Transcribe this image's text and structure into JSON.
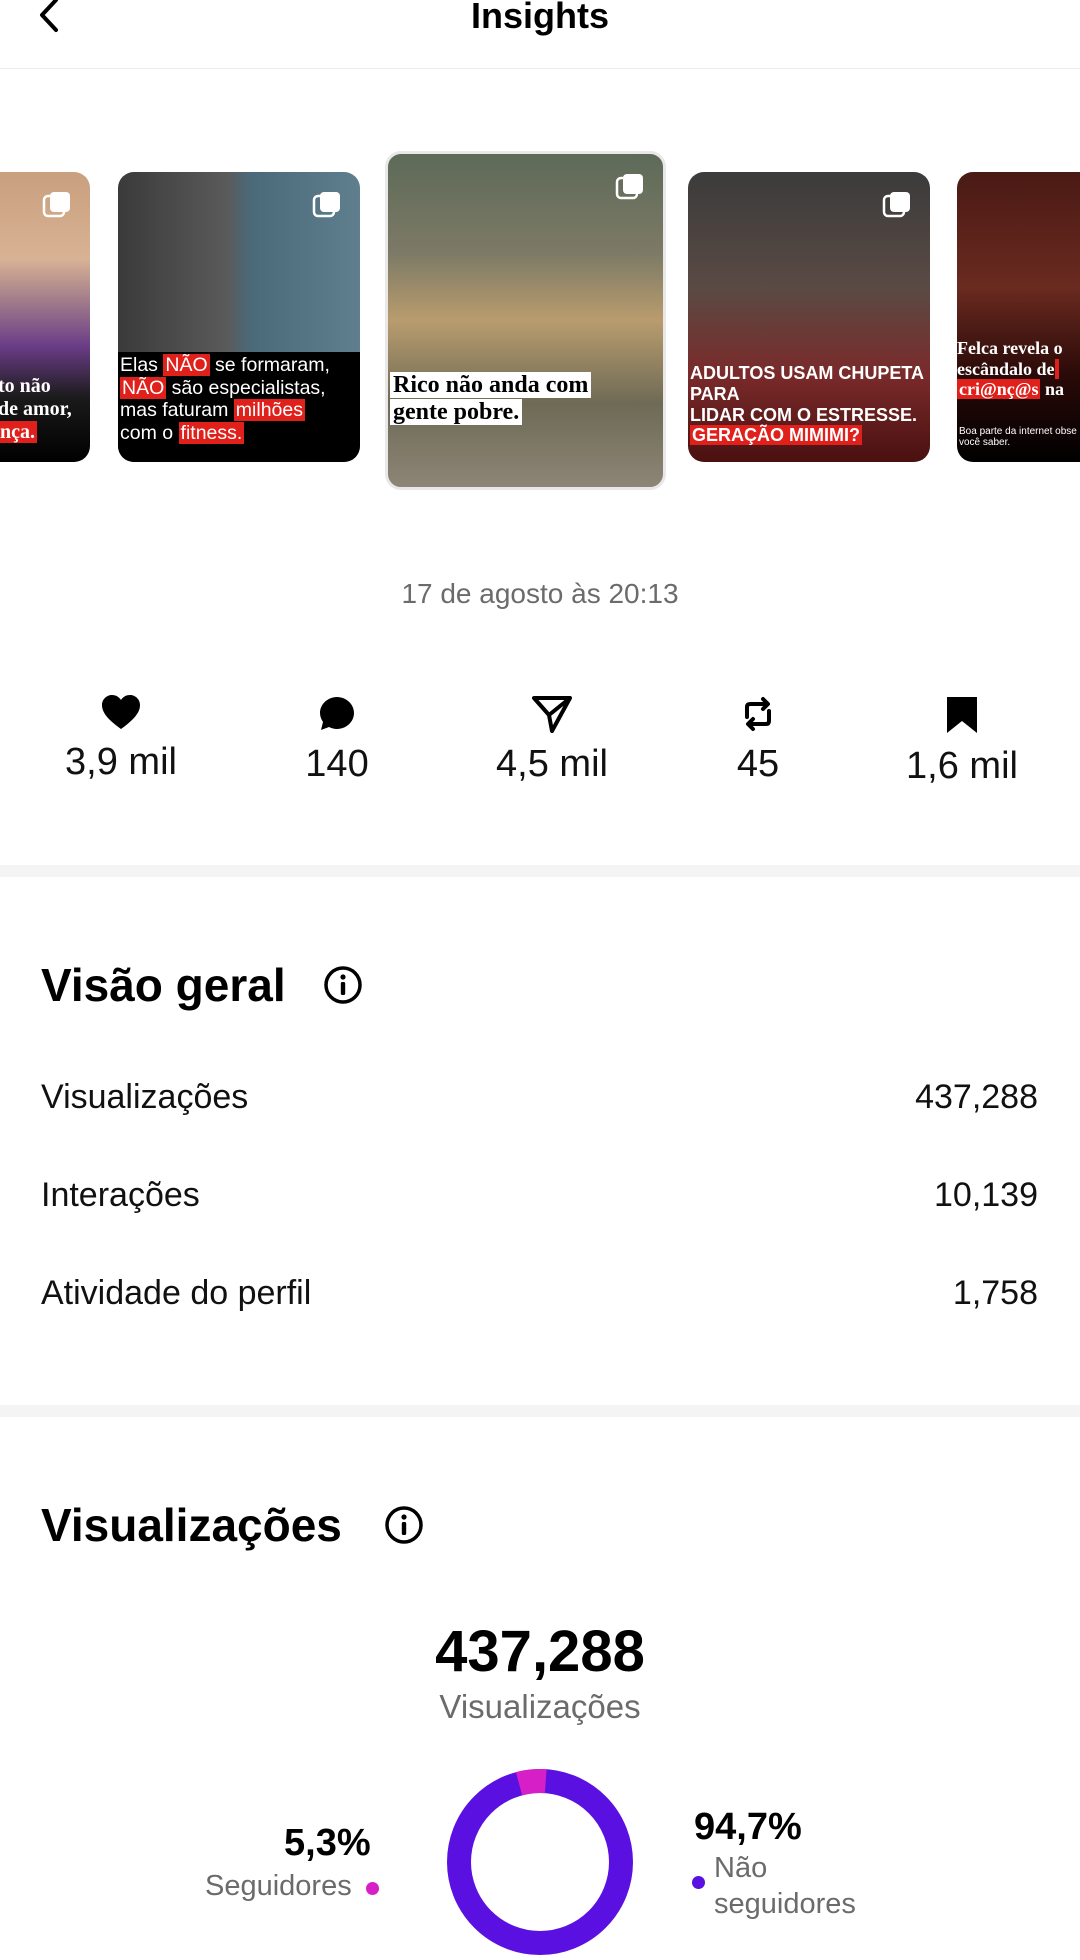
{
  "header": {
    "title": "Insights"
  },
  "carousel": [
    {
      "caption_parts": [
        {
          "t": "to não"
        },
        {
          "t": "\nde amor,"
        },
        {
          "t": "\nnça.",
          "hl": true
        }
      ]
    },
    {
      "caption_parts": [
        {
          "t": "Elas "
        },
        {
          "t": "NÃO",
          "hl": true
        },
        {
          "t": " se formaram,\n"
        },
        {
          "t": "NÃO",
          "hl": true
        },
        {
          "t": " são especialistas,\nmas faturam "
        },
        {
          "t": "milhões",
          "hl": true
        },
        {
          "t": "\ncom o "
        },
        {
          "t": "fitness.",
          "hl": true
        }
      ]
    },
    {
      "caption_parts": [
        {
          "t": "Rico não anda com\ngente pobre."
        }
      ]
    },
    {
      "caption_parts": [
        {
          "t": "ADULTOS USAM CHUPETA PARA\nLIDAR COM O ESTRESSE.\n"
        },
        {
          "t": "GERAÇÃO MIMIMI?",
          "hl": true
        }
      ]
    },
    {
      "caption_parts": [
        {
          "t": "Felca revela o\nescândalo de "
        },
        {
          "t": " ",
          "hl": true
        },
        {
          "t": "\n"
        },
        {
          "t": "cri@nç@s",
          "hl": true
        },
        {
          "t": " na"
        }
      ],
      "sub": "Boa parte da internet obse\nvocê saber."
    }
  ],
  "post": {
    "date": "17 de agosto às 20:13"
  },
  "metrics": [
    {
      "icon": "heart-icon",
      "value": "3,9 mil"
    },
    {
      "icon": "comment-icon",
      "value": "140"
    },
    {
      "icon": "share-icon",
      "value": "4,5 mil"
    },
    {
      "icon": "repost-icon",
      "value": "45"
    },
    {
      "icon": "bookmark-icon",
      "value": "1,6 mil"
    }
  ],
  "overview": {
    "title": "Visão geral",
    "rows": [
      {
        "label": "Visualizações",
        "value": "437,288"
      },
      {
        "label": "Interações",
        "value": "10,139"
      },
      {
        "label": "Atividade do perfil",
        "value": "1,758"
      }
    ]
  },
  "views": {
    "title": "Visualizações",
    "total": "437,288",
    "total_label": "Visualizações",
    "followers": {
      "pct": "5,3%",
      "label": "Seguidores",
      "fraction": 0.053,
      "color": "#d61fc7"
    },
    "non_followers": {
      "pct": "94,7%",
      "label": "Não seguidores",
      "fraction": 0.947,
      "color": "#5a10e0"
    }
  }
}
